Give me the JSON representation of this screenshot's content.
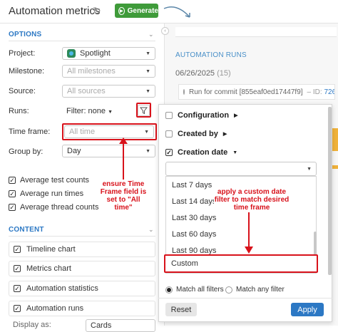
{
  "header": {
    "title": "Automation metrics",
    "generate_label": "Generate"
  },
  "options": {
    "section_label": "OPTIONS",
    "project": {
      "label": "Project:",
      "value": "Spotlight"
    },
    "milestone": {
      "label": "Milestone:",
      "placeholder": "All milestones"
    },
    "source": {
      "label": "Source:",
      "placeholder": "All sources"
    },
    "runs": {
      "label": "Runs:",
      "value": "Filter: none"
    },
    "timeframe": {
      "label": "Time frame:",
      "placeholder": "All time"
    },
    "groupby": {
      "label": "Group by:",
      "value": "Day"
    },
    "checks": [
      {
        "label": "Average test counts",
        "checked": true
      },
      {
        "label": "Average run times",
        "checked": true
      },
      {
        "label": "Average thread counts",
        "checked": true
      }
    ]
  },
  "content": {
    "section_label": "CONTENT",
    "items": [
      {
        "label": "Timeline chart",
        "checked": true
      },
      {
        "label": "Metrics chart",
        "checked": true
      },
      {
        "label": "Automation statistics",
        "checked": true
      },
      {
        "label": "Automation runs",
        "checked": true
      }
    ],
    "display_as": {
      "label": "Display as:",
      "value": "Cards"
    }
  },
  "automation_runs": {
    "section_label": "AUTOMATION RUNS",
    "date": "06/26/2025",
    "count": "(15)",
    "run_title": "Run for commit [855eaf0ed17447f9]",
    "run_id_label": "ID:",
    "run_id": "726"
  },
  "filter_popup": {
    "fields": [
      {
        "label": "Configuration",
        "checked": false,
        "expanded": false
      },
      {
        "label": "Created by",
        "checked": false,
        "expanded": false
      },
      {
        "label": "Creation date",
        "checked": true,
        "expanded": true
      }
    ],
    "date_options": [
      "Last 7 days",
      "Last 14 days",
      "Last 30 days",
      "Last 60 days",
      "Last 90 days"
    ],
    "selected_option": "Custom",
    "match_all": "Match all filters",
    "match_any": "Match any filter",
    "reset_label": "Reset",
    "apply_label": "Apply"
  },
  "annotations": {
    "timeframe_note": "ensure Time Frame field is set to \"All time\"",
    "custom_note": "apply a custom date filter to match desired time frame"
  },
  "colors": {
    "accent": "#2c78c4",
    "generate": "#3f9b3a",
    "annotation": "#d8121b"
  }
}
